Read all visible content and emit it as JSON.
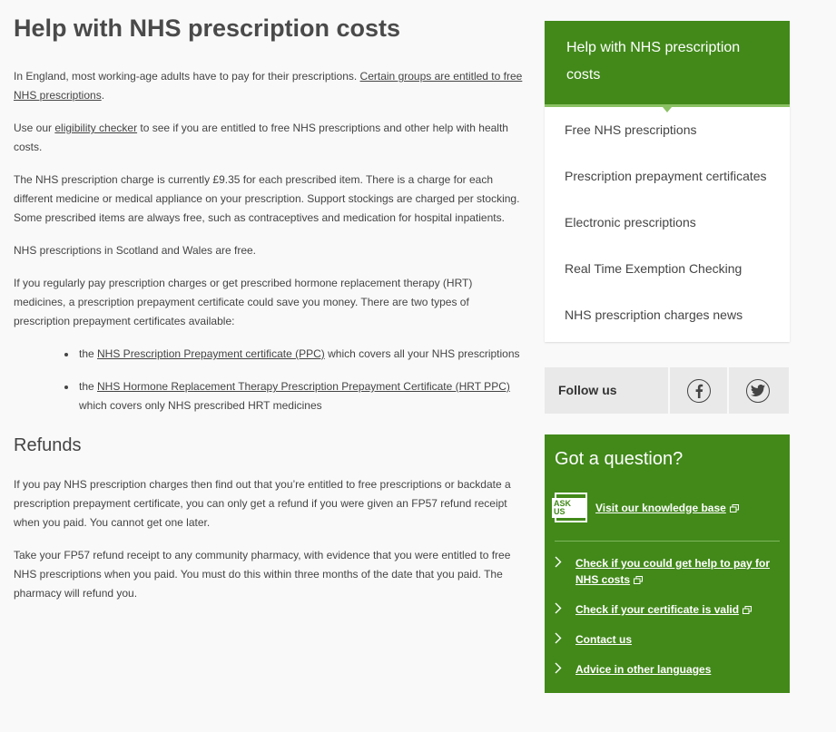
{
  "main": {
    "title": "Help with NHS prescription costs",
    "p1_text": "In England, most working-age adults have to pay for their prescriptions. ",
    "p1_link": "Certain groups are entitled to free NHS prescriptions",
    "p1_end": ".",
    "p2_pre": "Use our ",
    "p2_link": "eligibility checker",
    "p2_post": " to see if you are entitled to free NHS prescriptions and other help with health costs.",
    "p3": "The NHS prescription charge is currently £9.35 for each prescribed item. There is a charge for each different medicine or medical appliance on your prescription. Support stockings are charged per stocking. Some prescribed items are always free, such as contraceptives and medication for hospital inpatients.",
    "p4": "NHS prescriptions in Scotland and Wales are free.",
    "p5": "If you regularly pay prescription charges or get prescribed hormone replacement therapy (HRT) medicines, a prescription prepayment certificate could save you money. There are two types of prescription prepayment certificates available:",
    "bullets": [
      {
        "pre": "the ",
        "link": "NHS Prescription Prepayment certificate (PPC)",
        "post": " which covers all your NHS prescriptions"
      },
      {
        "pre": "the ",
        "link": "NHS Hormone Replacement Therapy Prescription Prepayment Certificate (HRT PPC)",
        "post": " which covers only NHS prescribed HRT medicines"
      }
    ],
    "refunds_heading": "Refunds",
    "r1": "If you pay NHS prescription charges then find out that you’re entitled to free prescriptions or backdate a prescription prepayment certificate, you can only get a refund if you were given an FP57 refund receipt when you paid. You cannot get one later.",
    "r2": "Take your FP57 refund receipt to any community pharmacy, with evidence that you were entitled to free NHS prescriptions when you paid. You must do this within three months of the date that you paid. The pharmacy will refund you."
  },
  "sidebar": {
    "nav_title": "Help with NHS prescription costs",
    "nav_items": [
      "Free NHS prescriptions",
      "Prescription prepayment certificates",
      "Electronic prescriptions",
      "Real Time Exemption Checking",
      "NHS prescription charges news"
    ],
    "follow_label": "Follow us",
    "question_title": "Got a question?",
    "ask_icon_text": "ASK US",
    "knowledge_base": "Visit our knowledge base",
    "links": [
      "Check if you could get help to pay for NHS costs",
      "Check if your certificate is valid",
      "Contact us",
      "Advice in other languages"
    ],
    "links_external": [
      true,
      true,
      false,
      false
    ]
  },
  "colors": {
    "brand_green": "#42891a",
    "background": "#f9f9f9",
    "text": "#444444"
  }
}
